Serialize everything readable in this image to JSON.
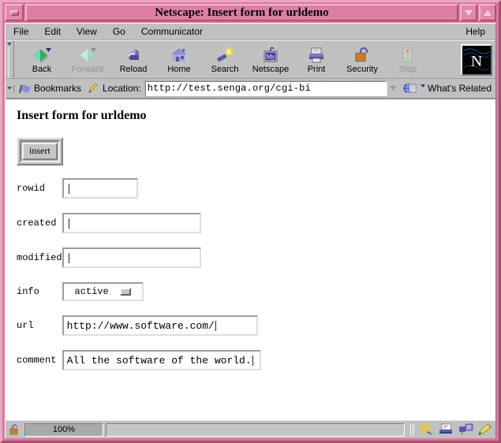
{
  "window": {
    "title": "Netscape: Insert form for urldemo",
    "menu_button_icon": "window-menu-icon",
    "minimize_icon": "triangle-down-icon",
    "maximize_icon": "triangle-up-icon"
  },
  "menubar": {
    "items": [
      {
        "label": "File"
      },
      {
        "label": "Edit"
      },
      {
        "label": "View"
      },
      {
        "label": "Go"
      },
      {
        "label": "Communicator"
      }
    ],
    "help_label": "Help"
  },
  "toolbar": {
    "buttons": [
      {
        "label": "Back",
        "icon": "back-arrow-icon",
        "disabled": false
      },
      {
        "label": "Forward",
        "icon": "forward-arrow-icon",
        "disabled": true
      },
      {
        "label": "Reload",
        "icon": "reload-icon",
        "disabled": false
      },
      {
        "label": "Home",
        "icon": "home-icon",
        "disabled": false
      },
      {
        "label": "Search",
        "icon": "search-flashlight-icon",
        "disabled": false
      },
      {
        "label": "Netscape",
        "icon": "my-netscape-icon",
        "disabled": false
      },
      {
        "label": "Print",
        "icon": "printer-icon",
        "disabled": false
      },
      {
        "label": "Security",
        "icon": "padlock-icon",
        "disabled": false
      },
      {
        "label": "Stop",
        "icon": "stop-sign-icon",
        "disabled": true
      }
    ],
    "logo": {
      "letter": "N",
      "icon": "netscape-logo-icon"
    }
  },
  "location_bar": {
    "bookmarks_label": "Bookmarks",
    "bookmarks_icon": "bookmark-flag-icon",
    "location_label": "Location:",
    "location_icon": "location-pen-icon",
    "url": "http://test.senga.org/cgi-bi",
    "url_dropdown_icon": "triangle-down-icon",
    "whats_related_label": "What's Related",
    "whats_related_icon": "whats-related-globe-icon"
  },
  "page": {
    "heading": "Insert form for urldemo",
    "submit_label": "insert",
    "fields": [
      {
        "name": "rowid",
        "label": "rowid",
        "type": "text",
        "value": "",
        "width_class": "w-rowid"
      },
      {
        "name": "created",
        "label": "created",
        "type": "text",
        "value": "",
        "width_class": "w-created"
      },
      {
        "name": "modified",
        "label": "modified",
        "type": "text",
        "value": "",
        "width_class": "w-modified"
      },
      {
        "name": "info",
        "label": "info",
        "type": "select",
        "value": "active",
        "options": [
          "active"
        ]
      },
      {
        "name": "url",
        "label": "url",
        "type": "text",
        "value": "http://www.software.com/",
        "width_class": "w-url"
      },
      {
        "name": "comment",
        "label": "comment",
        "type": "text",
        "value": "All the software of the world.",
        "width_class": "w-comment"
      }
    ]
  },
  "statusbar": {
    "security_icon": "unlocked-padlock-icon",
    "progress_text": "100%",
    "message": "",
    "component_icons": [
      {
        "name": "navigator-icon"
      },
      {
        "name": "mailbox-icon"
      },
      {
        "name": "newsgroups-icon"
      },
      {
        "name": "composer-icon"
      }
    ]
  },
  "colors": {
    "titlebar": "#d9789e",
    "frame": "#e8a9c0",
    "chrome": "#c0c0c0",
    "page_bg": "#ffffff"
  }
}
